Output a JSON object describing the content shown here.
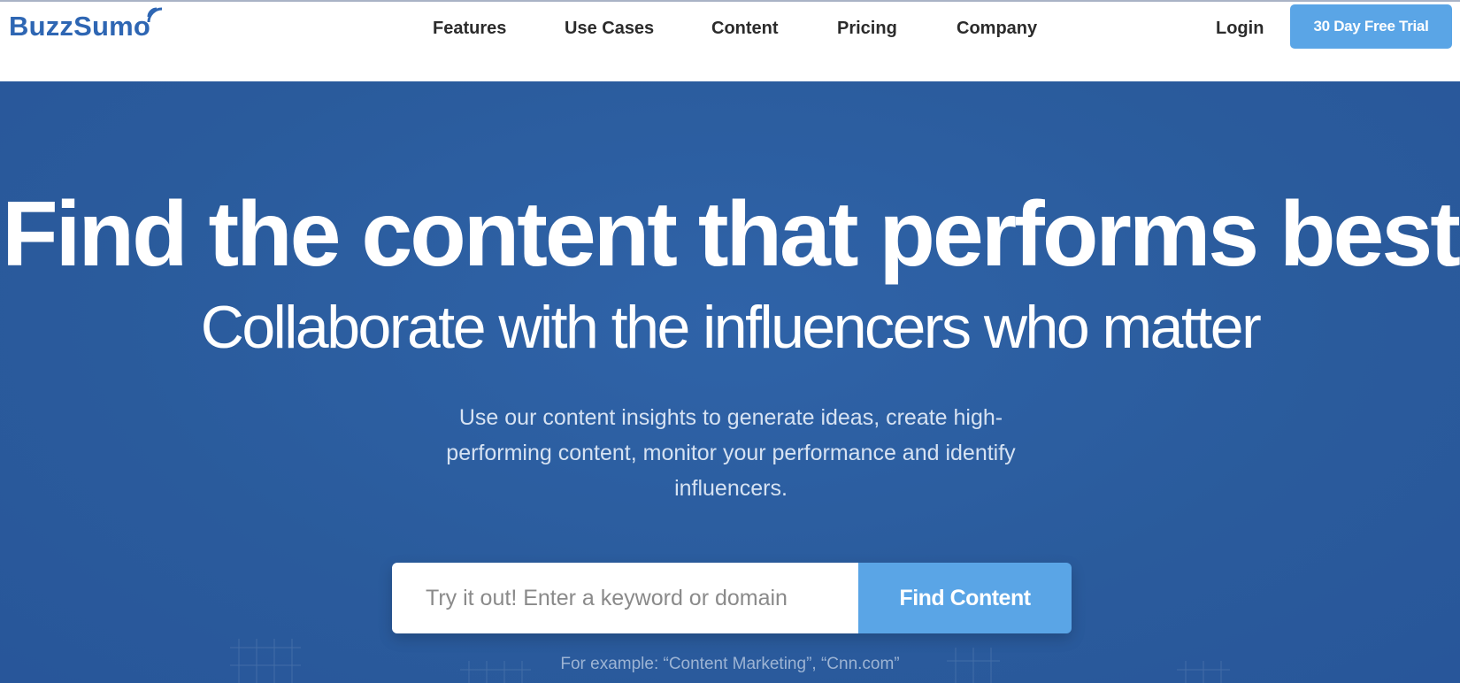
{
  "brand": {
    "logo_text": "BuzzSumo",
    "primary_color": "#2e66b3",
    "accent_color": "#5aa5e6",
    "hero_bg": "#2a5b9c"
  },
  "nav": {
    "items": [
      {
        "label": "Features"
      },
      {
        "label": "Use Cases"
      },
      {
        "label": "Content"
      },
      {
        "label": "Pricing"
      },
      {
        "label": "Company"
      }
    ],
    "login_label": "Login",
    "trial_label": "30 Day Free Trial"
  },
  "hero": {
    "title": "Find the content that performs best",
    "subtitle": "Collaborate with the influencers who matter",
    "description": "Use our content insights to generate ideas, create high-performing content, monitor your performance and identify influencers.",
    "search_placeholder": "Try it out! Enter a keyword or domain",
    "search_value": "",
    "search_button": "Find Content",
    "example_text": "For example: “Content Marketing”, “Cnn.com”"
  },
  "icons": {
    "logo_signal": "wifi-signal-icon"
  }
}
